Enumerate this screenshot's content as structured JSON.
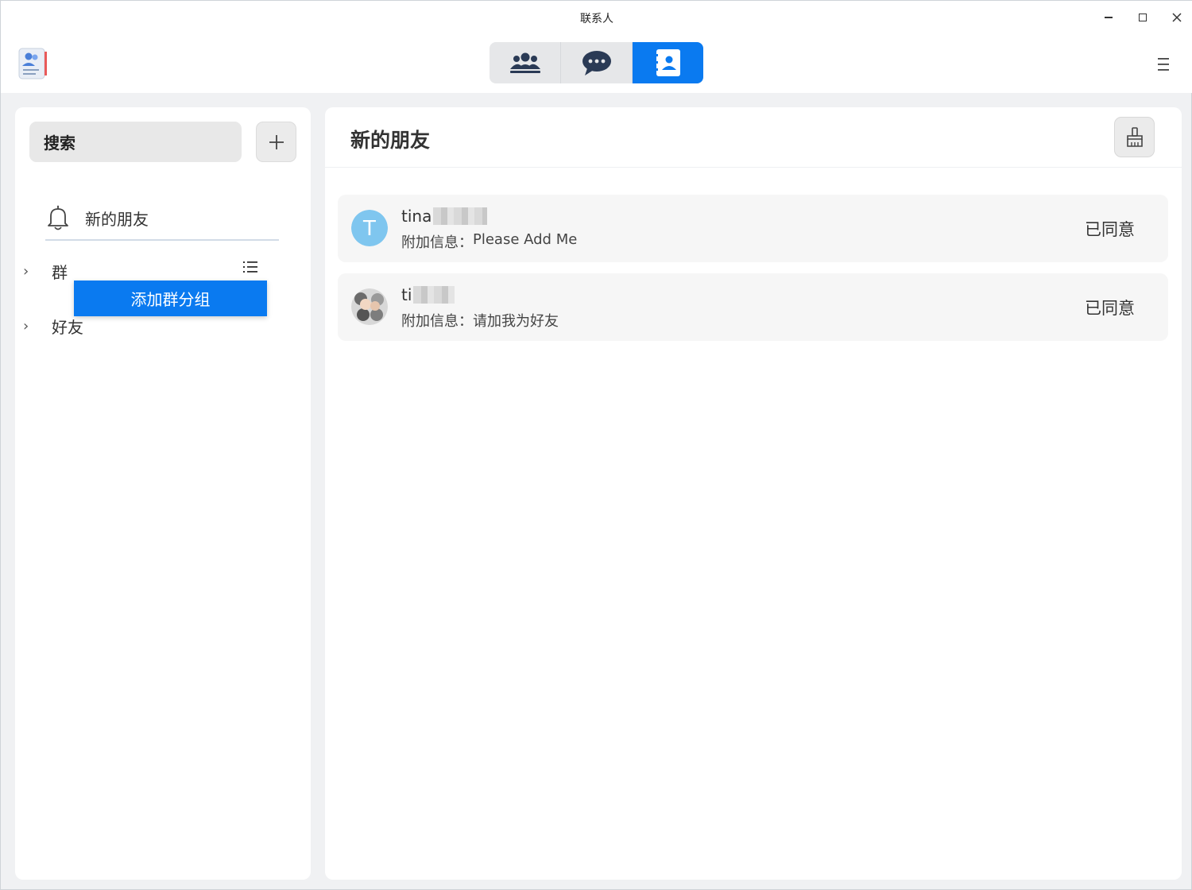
{
  "window": {
    "title": "联系人",
    "controls": [
      "minimize",
      "maximize",
      "close"
    ]
  },
  "toolbar": {
    "tabs": [
      {
        "name": "groups",
        "icon": "people-group-icon",
        "active": false
      },
      {
        "name": "chat",
        "icon": "chat-bubble-icon",
        "active": false
      },
      {
        "name": "contacts",
        "icon": "contact-card-icon",
        "active": true
      }
    ],
    "accent": "#0a7af0"
  },
  "sidebar": {
    "search_placeholder": "搜索",
    "new_friends_label": "新的朋友",
    "tree": [
      {
        "label": "群",
        "expanded": false
      },
      {
        "label": "好友",
        "expanded": false
      }
    ],
    "context_menu": {
      "item": "添加群分组"
    }
  },
  "main": {
    "title": "新的朋友",
    "note_prefix": "附加信息：",
    "requests": [
      {
        "name": "tina",
        "note": "Please Add Me",
        "status": "已同意",
        "avatar_letter": "T",
        "avatar_color": "#7fc6ef"
      },
      {
        "name": "ti",
        "note": "请加我为好友",
        "status": "已同意",
        "avatar_letter": "",
        "avatar_color": "#cfcfcf"
      }
    ]
  }
}
